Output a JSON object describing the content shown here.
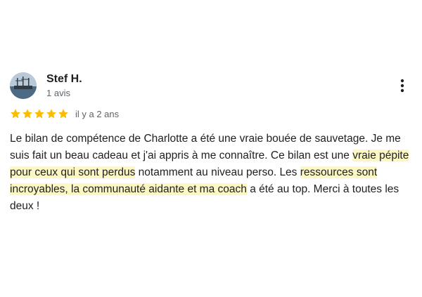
{
  "review": {
    "author_name": "Stef H.",
    "review_count": "1 avis",
    "rating": 5,
    "rating_max": 5,
    "star_color": "#fbbc04",
    "date": "il y a 2 ans",
    "more_icon": "more-vertical-icon",
    "highlight_color": "#fdf7c3",
    "text_part1": "Le bilan de compétence de Charlotte a été une vraie bouée de sauvetage. Je me suis fait un beau cadeau et j'ai appris à me connaître. Ce bilan est une ",
    "highlight1": "vraie pépite pour ceux qui sont perdus",
    "text_part2": " notamment au niveau perso. Les ",
    "highlight2": "ressources sont incroyables, la communauté aidante et ma coach",
    "text_part3": " a été au top. Merci à toutes les deux !"
  }
}
